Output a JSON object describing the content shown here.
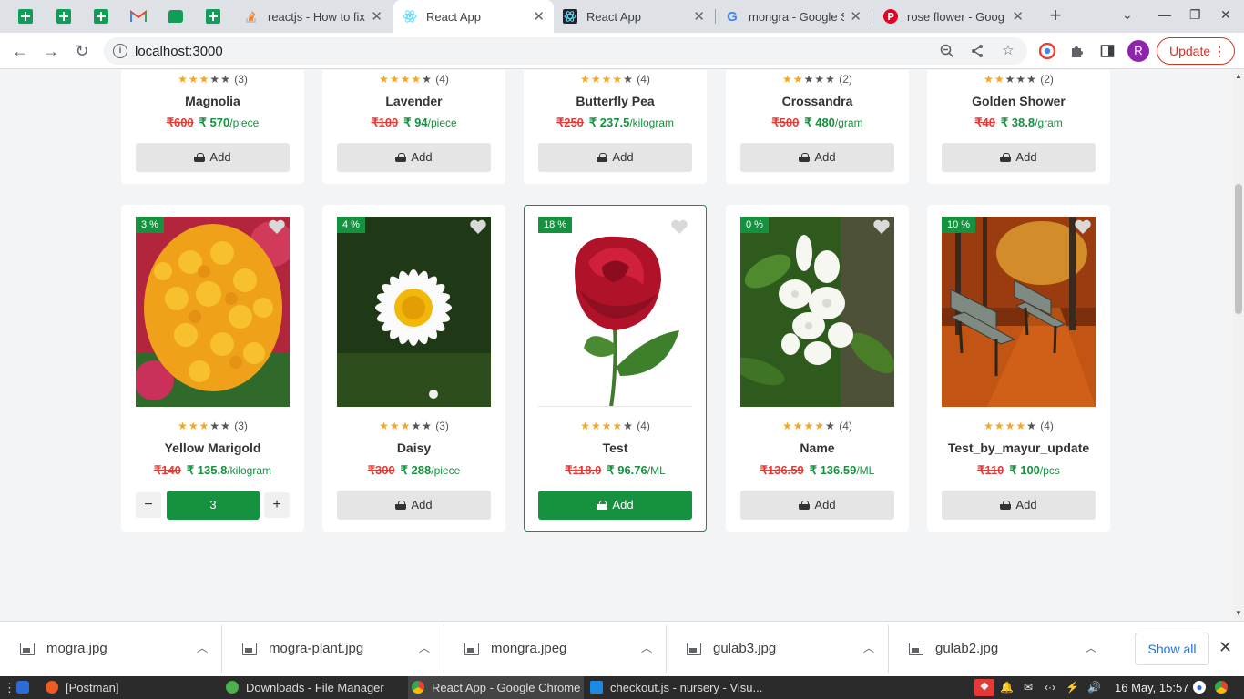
{
  "browser": {
    "tabs": [
      {
        "title": "reactjs - How to fix",
        "active": false
      },
      {
        "title": "React App",
        "active": true
      },
      {
        "title": "React App",
        "active": false
      },
      {
        "title": "mongra - Google S",
        "active": false
      },
      {
        "title": "rose flower - Goog",
        "active": false
      }
    ],
    "url": "localhost:3000",
    "profile_initial": "R",
    "update_label": "Update"
  },
  "top_row": [
    {
      "name": "Magnolia",
      "stars": 3,
      "reviews": "(3)",
      "old_price": "₹600",
      "new_price": "₹ 570",
      "unit": "/piece",
      "add_label": "Add"
    },
    {
      "name": "Lavender",
      "stars": 4,
      "reviews": "(4)",
      "old_price": "₹100",
      "new_price": "₹ 94",
      "unit": "/piece",
      "add_label": "Add"
    },
    {
      "name": "Butterfly Pea",
      "stars": 4,
      "reviews": "(4)",
      "old_price": "₹250",
      "new_price": "₹ 237.5",
      "unit": "/kilogram",
      "add_label": "Add"
    },
    {
      "name": "Crossandra",
      "stars": 2,
      "reviews": "(2)",
      "old_price": "₹500",
      "new_price": "₹ 480",
      "unit": "/gram",
      "add_label": "Add"
    },
    {
      "name": "Golden Shower",
      "stars": 2,
      "reviews": "(2)",
      "old_price": "₹40",
      "new_price": "₹ 38.8",
      "unit": "/gram",
      "add_label": "Add"
    }
  ],
  "bottom_row": [
    {
      "badge": "3 %",
      "name": "Yellow Marigold",
      "stars": 3,
      "reviews": "(3)",
      "old_price": "₹140",
      "new_price": "₹ 135.8",
      "unit": "/kilogram",
      "quantity": "3",
      "image": "yellow-marigold"
    },
    {
      "badge": "4 %",
      "name": "Daisy",
      "stars": 3,
      "reviews": "(3)",
      "old_price": "₹300",
      "new_price": "₹ 288",
      "unit": "/piece",
      "add_label": "Add",
      "image": "daisy"
    },
    {
      "badge": "18 %",
      "name": "Test",
      "stars": 4,
      "reviews": "(4)",
      "old_price": "₹118.0",
      "new_price": "₹ 96.76",
      "unit": "/ML",
      "add_label": "Add",
      "image": "red-rose"
    },
    {
      "badge": "0 %",
      "name": "Name",
      "stars": 4,
      "reviews": "(4)",
      "old_price": "₹136.59",
      "new_price": "₹ 136.59",
      "unit": "/ML",
      "add_label": "Add",
      "image": "white-jasmine"
    },
    {
      "badge": "10 %",
      "name": "Test_by_mayur_update",
      "stars": 4,
      "reviews": "(4)",
      "old_price": "₹110",
      "new_price": "₹ 100",
      "unit": "/pcs",
      "add_label": "Add",
      "image": "autumn-bench"
    }
  ],
  "downloads": {
    "items": [
      "mogra.jpg",
      "mogra-plant.jpg",
      "mongra.jpeg",
      "gulab3.jpg",
      "gulab2.jpg"
    ],
    "show_all": "Show all"
  },
  "taskbar": {
    "tasks": [
      "[Postman]",
      "Downloads - File Manager",
      "React App - Google Chrome",
      "checkout.js - nursery - Visu..."
    ],
    "clock": "16 May, 15:57"
  },
  "colors": {
    "brand_green": "#15913f",
    "old_price_red": "#e53935",
    "star": "#f5a623"
  }
}
